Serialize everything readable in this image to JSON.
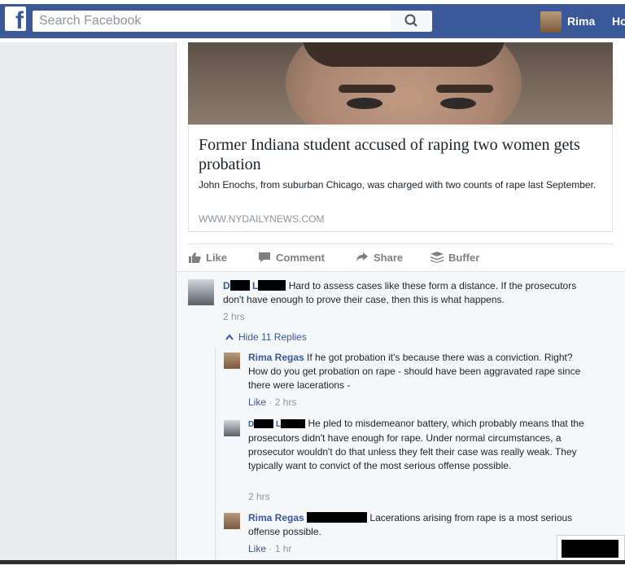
{
  "header": {
    "logo": "f",
    "search_placeholder": "Search Facebook",
    "user_name": "Rima",
    "home_link": "Ho"
  },
  "link_preview": {
    "title": "Former Indiana student accused of raping two women gets probation",
    "description": "John Enochs, from suburban Chicago, was charged with two counts of rape last September.",
    "domain": "WWW.NYDAILYNEWS.COM"
  },
  "actions": {
    "like": "Like",
    "comment": "Comment",
    "share": "Share",
    "buffer": "Buffer"
  },
  "comments": [
    {
      "name_initial_1": "D",
      "name_initial_2": "L",
      "text": "Hard to assess cases like these form a distance. If the prosecutors don't have enough to prove their case, then this is what happens.",
      "time": "2 hrs"
    }
  ],
  "replies_toggle": "Hide 11 Replies",
  "replies": [
    {
      "name": "Rima Regas",
      "text": "If he got probation it's because there was a conviction. Right? How do you get probation on rape - should have been aggravated rape since there were lacerations -",
      "like": "Like",
      "time": "2 hrs"
    },
    {
      "name_initial_1": "D",
      "name_initial_2": "L",
      "text": "He pled to misdemeanor battery, which probably means that the prosecutors didn't have enough for rape. Under normal circumstances, a prosecutor wouldn't do that unless they felt their case was really weak. They typically want to convict of the most serious offense possible.",
      "time": "2 hrs"
    },
    {
      "name": "Rima Regas",
      "text": "Lacerations arising from rape is a most serious offense possible.",
      "like": "Like",
      "time": "1 hr"
    }
  ],
  "colors": {
    "brand_blue": "#3b5998",
    "link_blue": "#365899",
    "meta_gray": "#90949c"
  }
}
